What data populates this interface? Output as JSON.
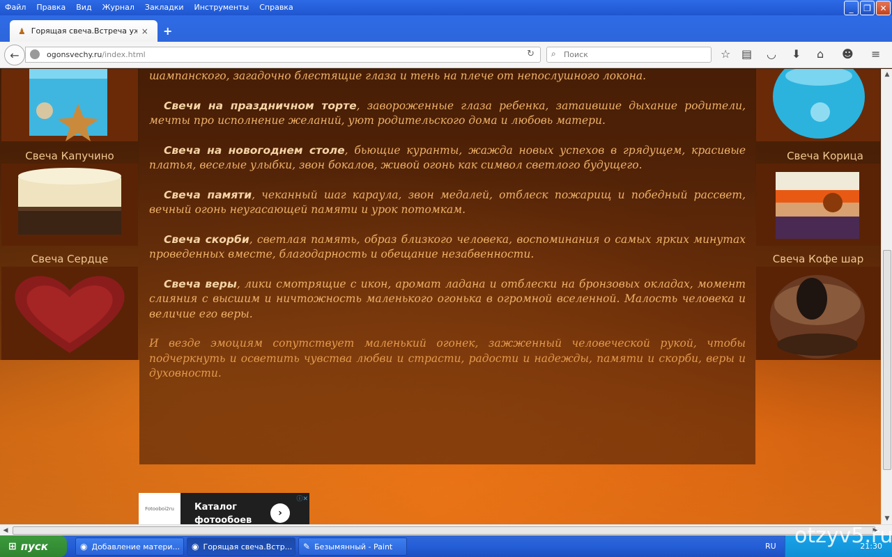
{
  "menubar": {
    "items": [
      "Файл",
      "Правка",
      "Вид",
      "Журнал",
      "Закладки",
      "Инструменты",
      "Справка"
    ]
  },
  "window": {
    "minimize": "_",
    "restore": "❐",
    "close": "✕"
  },
  "tab": {
    "title": "Горящая свеча.Встреча уж...",
    "close": "×",
    "new_tab": "+"
  },
  "navbar": {
    "url_host": "ogonsvechy.ru",
    "url_path": "/index.html",
    "search_placeholder": "Поиск"
  },
  "left_candles": [
    {
      "caption": "Свеча Капучино"
    },
    {
      "caption": "Свеча Сердце"
    }
  ],
  "right_candles": [
    {
      "caption": "Свеча Корица"
    },
    {
      "caption": "Свеча Кофе шар"
    }
  ],
  "article": {
    "top_line": "шампанского, загадочно блестящие глаза и тень на плече от непослушного локона.",
    "paragraphs": [
      {
        "bold": "Свечи на праздничном торте",
        "text": ", завороженные глаза ребенка, затаившие дыхание родители, мечты про исполнение желаний, уют родительского дома и любовь матери."
      },
      {
        "bold": "Свеча на новогоднем столе",
        "text": ", бьющие куранты, жажда новых успехов в грядущем, красивые платья, веселые улыбки, звон бокалов, живой огонь как символ светлого будущего."
      },
      {
        "bold": "Свеча памяти",
        "text": ", чеканный шаг караула, звон медалей, отблеск пожарищ и победный рассвет, вечный огонь неугасающей памяти и урок потомкам."
      },
      {
        "bold": "Свеча скорби",
        "text": ", светлая память, образ близкого человека, воспоминания о самых ярких минутах проведенных вместе, благодарность и обещание незабвенности."
      },
      {
        "bold": "Свеча веры",
        "text": ", лики смотрящие с икон, аромат ладана и отблески на бронзовых окладах, момент слияния с высшим и ничтожность маленького огонька в огромной вселенной. Малость человека и величие его веры."
      }
    ],
    "closing": "И везде эмоциям сопутствует маленький огонек, зажженный человеческой рукой, чтобы подчеркнуть и осветить чувства любви и страсти, радости и надежды, памяти и скорби, веры и духовности."
  },
  "ad": {
    "brand": "Fotooboi2ru",
    "line1": "Каталог",
    "line2": "фотообоев",
    "go": "›"
  },
  "taskbar": {
    "start": "пуск",
    "tasks": [
      "Добавление матери...",
      "Горящая свеча.Встр...",
      "Безымянный - Paint"
    ],
    "lang": "RU",
    "clock": "21:30"
  },
  "watermark": "otzyv5.ru",
  "colors": {
    "text": "#f0b26a",
    "bold": "#f6d4a6",
    "caption": "#f1c892"
  }
}
